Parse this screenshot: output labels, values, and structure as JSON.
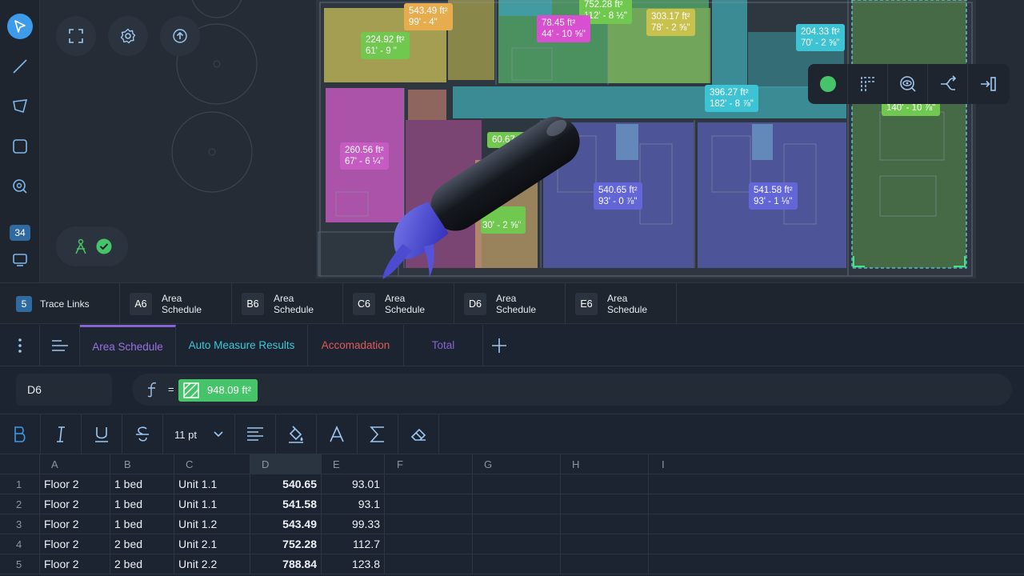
{
  "app": {
    "link_count": "34",
    "colors": {
      "accent": "#3d9be9",
      "green": "#47c46a",
      "purple": "#8a63d2",
      "teal": "#3fb6c6",
      "red": "#e05a5a"
    }
  },
  "left_toolbar": {
    "icons": [
      "select-arrow-icon",
      "line-tool-icon",
      "polygon-tool-icon",
      "rectangle-tool-icon",
      "search-zoom-icon",
      "monitor-icon"
    ]
  },
  "plan_tags": [
    {
      "area": "543.49 ft²",
      "dim": "99' - 4\""
    },
    {
      "area": "224.92 ft²",
      "dim": "61' - 9 \""
    },
    {
      "area": "752.28 ft²",
      "dim": "112' - 8 ½\""
    },
    {
      "area": "78.45 ft²",
      "dim": "44' - 10 ⅝\""
    },
    {
      "area": "303.17 ft²",
      "dim": "78' - 2 ⅝\""
    },
    {
      "area": "204.33 ft²",
      "dim": "70' - 2 ⅝\""
    },
    {
      "area": "396.27 ft²",
      "dim": "182' - 8 ⅞\""
    },
    {
      "area": "260.56 ft²",
      "dim": "67' - 6 ¼\""
    },
    {
      "area": "540.65 ft²",
      "dim": "93' - 0 ⅞\""
    },
    {
      "area": "541.58 ft²",
      "dim": "93' - 1 ⅛\""
    },
    {
      "area": "60.67",
      "dim": ""
    },
    {
      "area": "",
      "dim": "30' - 2 ⅝\""
    },
    {
      "area": "",
      "dim": "140' - 10 ⅞\""
    }
  ],
  "trace_links": {
    "count": "5",
    "label": "Trace Links",
    "items": [
      {
        "code": "A6",
        "label": "Area Schedule"
      },
      {
        "code": "B6",
        "label": "Area Schedule"
      },
      {
        "code": "C6",
        "label": "Area Schedule"
      },
      {
        "code": "D6",
        "label": "Area Schedule"
      },
      {
        "code": "E6",
        "label": "Area Schedule"
      }
    ]
  },
  "tabs": [
    {
      "label": "Area Schedule",
      "color": "#9a72e4"
    },
    {
      "label": "Auto Measure Results",
      "color": "#3fc7d6"
    },
    {
      "label": "Accomadation",
      "color": "#e05a5a"
    },
    {
      "label": "Total",
      "color": "#8a63d2"
    }
  ],
  "formula": {
    "cell_ref": "D6",
    "equals": "=",
    "value": "948.09 ft²"
  },
  "format": {
    "font_size": "11 pt"
  },
  "grid": {
    "columns": [
      "A",
      "B",
      "C",
      "D",
      "E",
      "F",
      "G",
      "H",
      "I"
    ],
    "rows": [
      {
        "n": "1",
        "a": "Floor 2",
        "b": "1 bed",
        "c": "Unit 1.1",
        "d": "540.65",
        "e": "93.01"
      },
      {
        "n": "2",
        "a": "Floor 2",
        "b": "1 bed",
        "c": "Unit 1.1",
        "d": "541.58",
        "e": "93.1"
      },
      {
        "n": "3",
        "a": "Floor 2",
        "b": "1 bed",
        "c": "Unit 1.2",
        "d": "543.49",
        "e": "99.33"
      },
      {
        "n": "4",
        "a": "Floor 2",
        "b": "2 bed",
        "c": "Unit 2.1",
        "d": "752.28",
        "e": "112.7"
      },
      {
        "n": "5",
        "a": "Floor 2",
        "b": "2 bed",
        "c": "Unit 2.2",
        "d": "788.84",
        "e": "123.8"
      }
    ]
  }
}
